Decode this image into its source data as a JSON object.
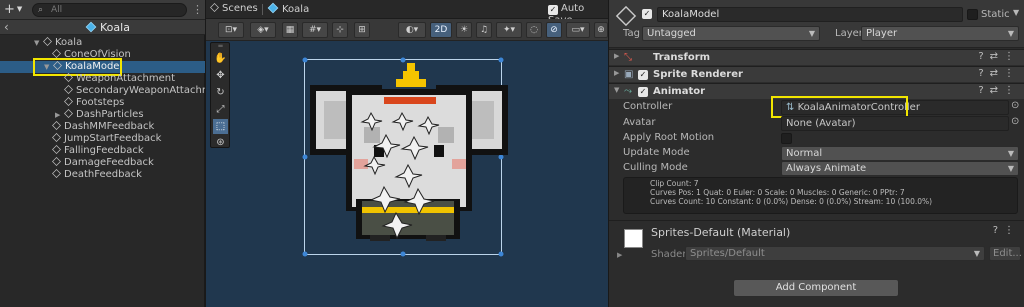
{
  "hierarchy": {
    "search_placeholder": "All",
    "header_title": "Koala",
    "tree": [
      {
        "label": "Koala"
      },
      {
        "label": "ConeOfVision"
      },
      {
        "label": "KoalaModel"
      },
      {
        "label": "WeaponAttachment"
      },
      {
        "label": "SecondaryWeaponAttachment"
      },
      {
        "label": "Footsteps"
      },
      {
        "label": "DashParticles"
      },
      {
        "label": "DashMMFeedback"
      },
      {
        "label": "JumpStartFeedback"
      },
      {
        "label": "FallingFeedback"
      },
      {
        "label": "DamageFeedback"
      },
      {
        "label": "DeathFeedback"
      }
    ]
  },
  "scene": {
    "breadcrumb_root": "Scenes",
    "breadcrumb_prefab": "Koala",
    "auto_save_label": "Auto Save",
    "toolbar_2d_label": "2D"
  },
  "inspector": {
    "object_name": "KoalaModel",
    "static_label": "Static",
    "tag_label": "Tag",
    "tag_value": "Untagged",
    "layer_label": "Layer",
    "layer_value": "Player",
    "components": {
      "transform": "Transform",
      "sprite_renderer": "Sprite Renderer",
      "animator": "Animator"
    },
    "animator": {
      "controller_label": "Controller",
      "controller_value": "KoalaAnimatorController",
      "avatar_label": "Avatar",
      "avatar_value": "None (Avatar)",
      "apply_root_motion_label": "Apply Root Motion",
      "update_mode_label": "Update Mode",
      "update_mode_value": "Normal",
      "culling_mode_label": "Culling Mode",
      "culling_mode_value": "Always Animate",
      "info_line1": "Clip Count: 7",
      "info_line2": "Curves Pos: 1 Quat: 0 Euler: 0 Scale: 0 Muscles: 0 Generic: 0 PPtr: 7",
      "info_line3": "Curves Count: 10 Constant: 0 (0.0%) Dense: 0 (0.0%) Stream: 10 (100.0%)"
    },
    "material": {
      "title": "Sprites-Default (Material)",
      "shader_label": "Shader",
      "shader_value": "Sprites/Default",
      "edit_label": "Edit..."
    },
    "add_component_label": "Add Component"
  },
  "colors": {
    "highlight": "#f2e600",
    "selection": "#2c5d87",
    "scene_bg": "#20374e"
  }
}
